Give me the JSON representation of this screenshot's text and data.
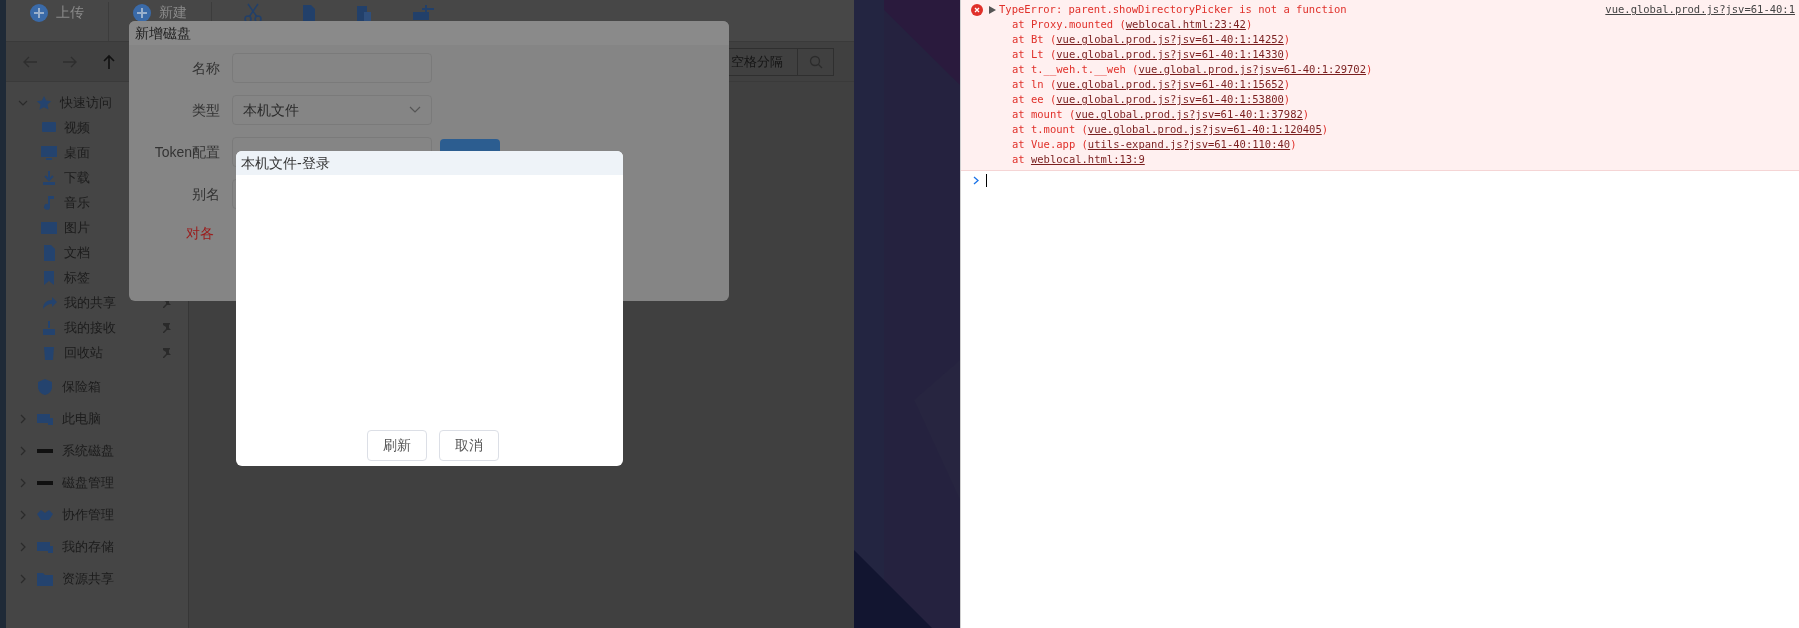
{
  "explorer": {
    "toolbar": [
      {
        "label": "上传"
      },
      {
        "label": "新建"
      }
    ],
    "search": {
      "placeholder": "空格分隔"
    },
    "sidebar": {
      "quick_access": {
        "label": "快速访问",
        "expanded": true,
        "children": [
          {
            "label": "视频"
          },
          {
            "label": "桌面"
          },
          {
            "label": "下载"
          },
          {
            "label": "音乐"
          },
          {
            "label": "图片"
          },
          {
            "label": "文档"
          },
          {
            "label": "标签"
          },
          {
            "label": "我的共享",
            "pinned": true
          },
          {
            "label": "我的接收",
            "pinned": true
          },
          {
            "label": "回收站",
            "pinned": true
          }
        ]
      },
      "sections": [
        {
          "label": "保险箱",
          "kind": "leaf"
        },
        {
          "label": "此电脑",
          "kind": "folder",
          "expanded": false
        },
        {
          "label": "系统磁盘",
          "kind": "folder",
          "expanded": false
        },
        {
          "label": "磁盘管理",
          "kind": "folder",
          "expanded": false
        },
        {
          "label": "协作管理",
          "kind": "folder",
          "expanded": false
        },
        {
          "label": "我的存储",
          "kind": "folder",
          "expanded": false
        },
        {
          "label": "资源共享",
          "kind": "folder",
          "expanded": false
        }
      ]
    }
  },
  "add_disk_dialog": {
    "title": "新增磁盘",
    "fields": [
      {
        "label": "名称",
        "kind": "input"
      },
      {
        "label": "类型",
        "kind": "select",
        "value": "本机文件"
      },
      {
        "label": "Token配置",
        "kind": "input_button"
      },
      {
        "label": "别名",
        "kind": "input"
      }
    ],
    "note": "对各"
  },
  "login_dialog": {
    "title": "本机文件-登录",
    "buttons": [
      "刷新",
      "取消"
    ]
  },
  "console": {
    "error": {
      "message": "TypeError: parent.showDirectoryPicker is not a function",
      "source": "vue.global.prod.js?jsv=61-40:1",
      "expanded": false
    },
    "stack": [
      {
        "prefix": "at Proxy.mounted (",
        "link": "weblocal.html:23:42",
        "suffix": ")"
      },
      {
        "prefix": "at Bt (",
        "link": "vue.global.prod.js?jsv=61-40:1:14252",
        "suffix": ")"
      },
      {
        "prefix": "at Lt (",
        "link": "vue.global.prod.js?jsv=61-40:1:14330",
        "suffix": ")"
      },
      {
        "prefix": "at t.__weh.t.__weh (",
        "link": "vue.global.prod.js?jsv=61-40:1:29702",
        "suffix": ")"
      },
      {
        "prefix": "at ln (",
        "link": "vue.global.prod.js?jsv=61-40:1:15652",
        "suffix": ")"
      },
      {
        "prefix": "at ee (",
        "link": "vue.global.prod.js?jsv=61-40:1:53800",
        "suffix": ")"
      },
      {
        "prefix": "at mount (",
        "link": "vue.global.prod.js?jsv=61-40:1:37982",
        "suffix": ")"
      },
      {
        "prefix": "at t.mount (",
        "link": "vue.global.prod.js?jsv=61-40:1:120405",
        "suffix": ")"
      },
      {
        "prefix": "at Vue.app (",
        "link": "utils-expand.js?jsv=61-40:110:40",
        "suffix": ")"
      },
      {
        "prefix": "at ",
        "link": "weblocal.html:13:9"
      }
    ]
  }
}
